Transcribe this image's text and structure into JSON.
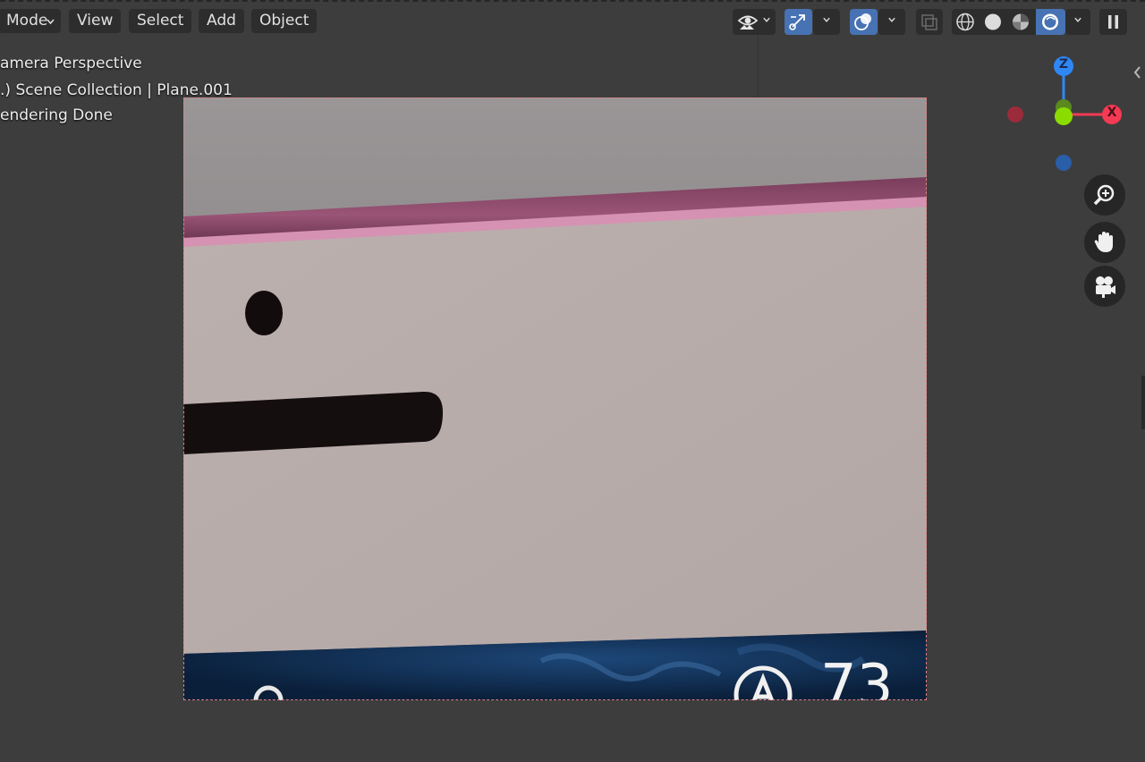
{
  "menubar": {
    "mode_label": "Mode",
    "view_label": "View",
    "select_label": "Select",
    "add_label": "Add",
    "object_label": "Object"
  },
  "toolbar": {
    "icons": [
      "visibility-icon",
      "gizmo-icon",
      "overlay-icon",
      "xray-icon",
      "wireframe-shading-icon",
      "solid-shading-icon",
      "material-shading-icon",
      "rendered-shading-icon",
      "pause-icon"
    ],
    "active_color": "#4772b3"
  },
  "viewport_info": {
    "line1": "amera Perspective",
    "line2": ".) Scene Collection | Plane.001",
    "line3": "endering Done"
  },
  "axis_gizmo": {
    "z_label": "Z",
    "x_label": "X",
    "z_color": "#2f87f5",
    "x_color": "#f53a54",
    "y_color": "#8bdc00"
  },
  "navigation": {
    "zoom_icon": "zoom-icon",
    "pan_icon": "hand-icon",
    "camera_icon": "camera-icon"
  },
  "render": {
    "partial_text": "73",
    "colors": {
      "wall": "#b8abaa",
      "bar": "#8a4a6a",
      "band": "#0c2442"
    }
  }
}
